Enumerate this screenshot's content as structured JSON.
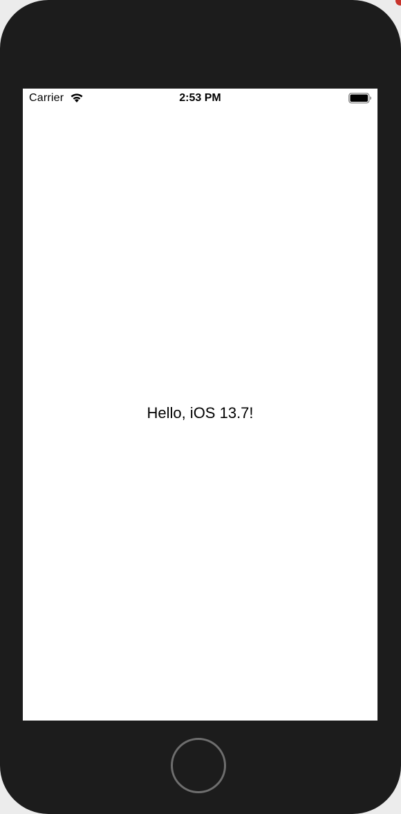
{
  "status_bar": {
    "carrier": "Carrier",
    "time": "2:53 PM",
    "wifi_icon": "wifi-icon",
    "battery_icon": "battery-icon"
  },
  "content": {
    "greeting": "Hello, iOS 13.7!"
  },
  "device": {
    "home_button_icon": "home-button",
    "frame_color": "#1c1c1c",
    "screen_color": "#ffffff"
  }
}
